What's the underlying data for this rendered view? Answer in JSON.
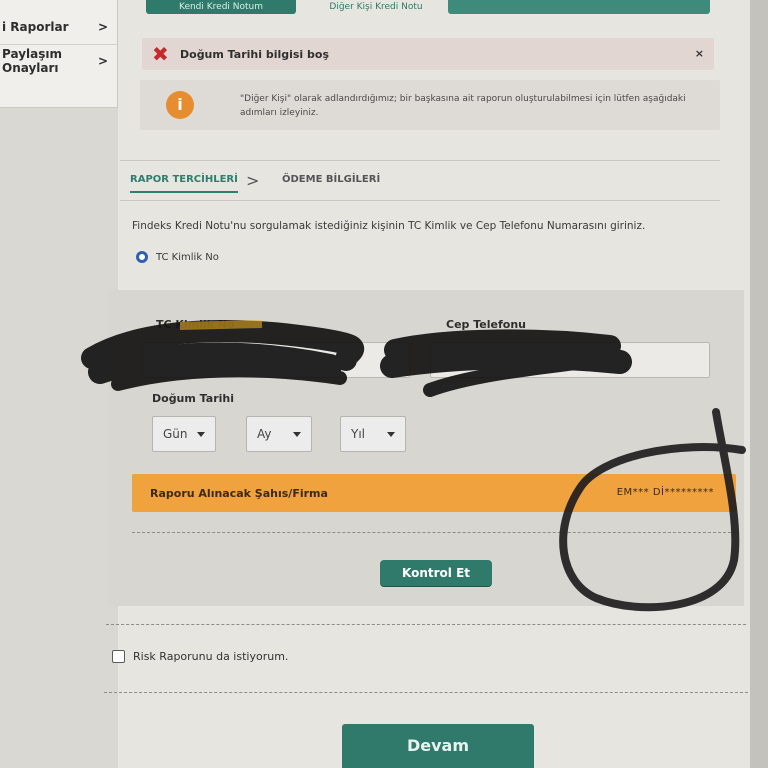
{
  "sidebar": {
    "items": [
      {
        "label": "i Raporlar",
        "chevron": ">"
      },
      {
        "label": "Paylaşım Onayları",
        "chevron": ">"
      }
    ]
  },
  "top_tabs": [
    {
      "label": "Kendi Kredi Notum"
    },
    {
      "label": "Diğer Kişi Kredi Notu"
    },
    {
      "label": ""
    }
  ],
  "alerts": {
    "error_text": "Doğum Tarihi bilgisi boş",
    "close_label": "×",
    "info_symbol": "i",
    "info_text": "\"Diğer Kişi\" olarak adlandırdığımız; bir başkasına ait raporun oluşturulabilmesi için lütfen aşağıdaki adımları izleyiniz."
  },
  "steps": {
    "active": "RAPOR TERCİHLERİ",
    "arrow": ">",
    "next": "ÖDEME BİLGİLERİ"
  },
  "lead_text": "Findeks Kredi Notu'nu sorgulamak istediğiniz kişinin TC Kimlik ve Cep Telefonu Numarasını giriniz.",
  "radio": {
    "label": "TC Kimlik No",
    "selected": true
  },
  "form": {
    "tc_label": "TC Kimlik No",
    "phone_label": "Cep Telefonu",
    "dob_label": "Doğum Tarihi",
    "day": "Gün",
    "month": "Ay",
    "year": "Yıl",
    "recipient_label": "Raporu Alınacak Şahıs/Firma",
    "recipient_value": "EM*** Dİ*********",
    "check_button": "Kontrol Et"
  },
  "risk_checkbox": {
    "label": "Risk Raporunu da istiyorum.",
    "checked": false
  },
  "continue_button": "Devam",
  "colors": {
    "accent_green": "#2f7a6a",
    "orange": "#f0a23e",
    "error_red": "#c42a2a",
    "info_orange": "#e58d2f"
  }
}
